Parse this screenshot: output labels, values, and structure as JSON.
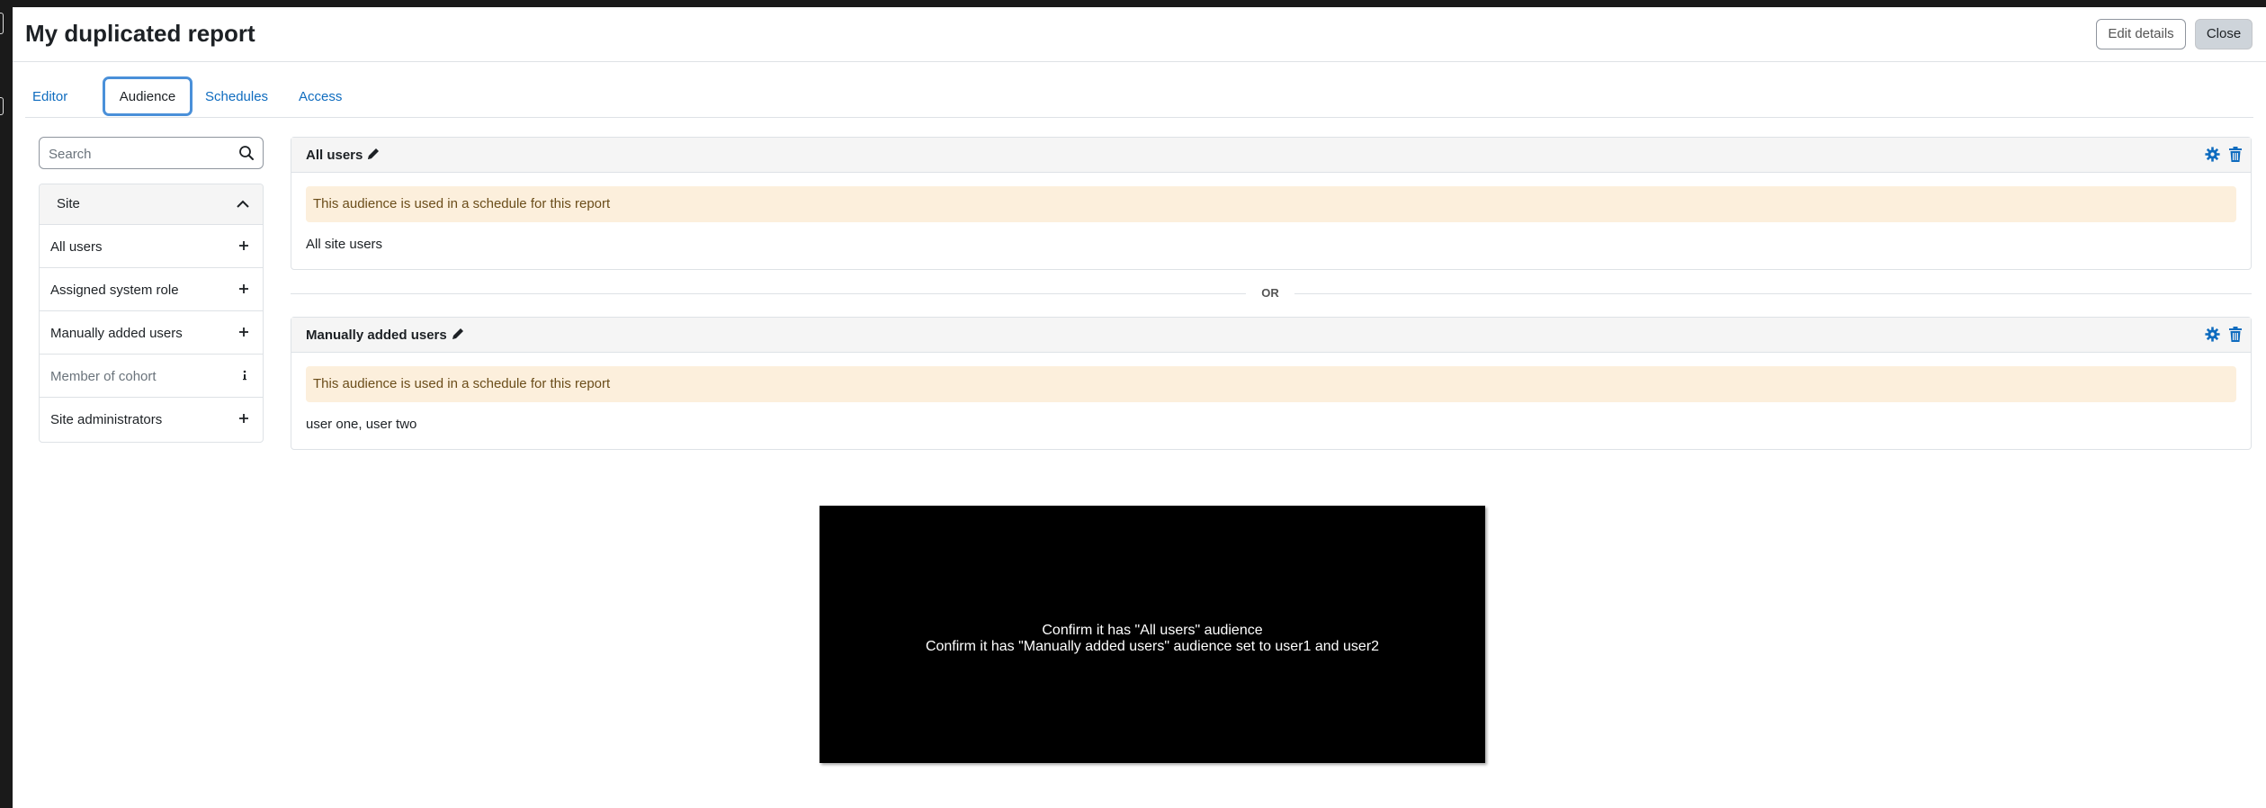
{
  "header": {
    "title": "My duplicated report",
    "edit_label": "Edit details",
    "close_label": "Close"
  },
  "tabs": [
    {
      "label": "Editor"
    },
    {
      "label": "Audience",
      "active": true
    },
    {
      "label": "Schedules"
    },
    {
      "label": "Access"
    }
  ],
  "search": {
    "placeholder": "Search"
  },
  "sidebar": {
    "section": "Site",
    "items": [
      {
        "label": "All users",
        "icon": "plus-icon"
      },
      {
        "label": "Assigned system role",
        "icon": "plus-icon"
      },
      {
        "label": "Manually added users",
        "icon": "plus-icon"
      },
      {
        "label": "Member of cohort",
        "icon": "info-icon",
        "disabled": true
      },
      {
        "label": "Site administrators",
        "icon": "plus-icon"
      }
    ]
  },
  "audiences": [
    {
      "title": "All users",
      "notice": "This audience is used in a schedule for this report",
      "description": "All site users"
    },
    {
      "title": "Manually added users",
      "notice": "This audience is used in a schedule for this report",
      "description": "user one, user two"
    }
  ],
  "separator": "OR",
  "overlay": {
    "line1": "Confirm it has \"All users\" audience",
    "line2": "Confirm it has \"Manually added users\" audience set to user1 and user2"
  },
  "colors": {
    "link": "#0f6cbf",
    "notice_bg": "#fcefdc",
    "tab_focus": "#4a90d9"
  }
}
